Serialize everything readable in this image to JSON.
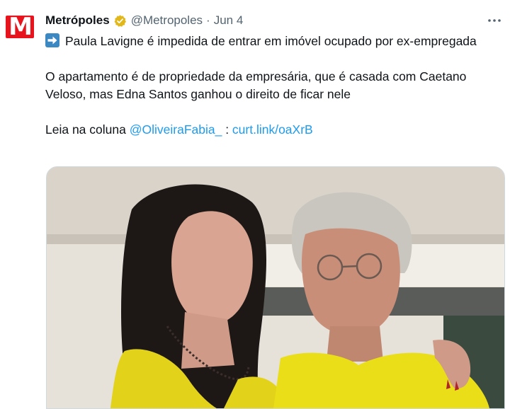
{
  "tweet": {
    "author_name": "Metrópoles",
    "author_handle": "@Metropoles",
    "separator": "·",
    "date": "Jun 4",
    "avatar_letter": "M",
    "headline": "Paula Lavigne é impedida de entrar em imóvel ocupado por ex-empregada",
    "headline_icon": "right-arrow-emoji-icon",
    "body": "O apartamento é de propriedade da empresária, que é casada com Caetano Veloso, mas Edna Santos ganhou o direito de ficar nele",
    "read_prefix": "Leia na coluna",
    "mention": "@OliveiraFabia_",
    "colon": " : ",
    "short_link": "curt.link/oaXrB",
    "more_icon": "more-options-icon",
    "verified_icon": "verified-gold-badge-icon"
  },
  "colors": {
    "brand_red": "#e8141d",
    "link_blue": "#1d9bf0",
    "secondary_text": "#536471",
    "verified_gold": "#e2b719"
  }
}
